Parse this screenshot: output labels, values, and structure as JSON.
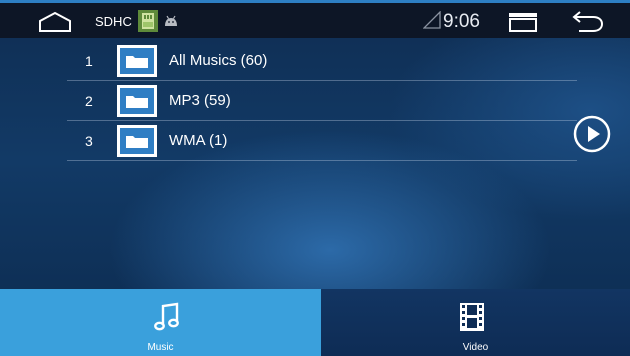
{
  "status_bar": {
    "storage_label": "SDHC",
    "time": "9:06",
    "icons": [
      "home-icon",
      "sd-card-icon",
      "android-debug-icon",
      "signal-icon",
      "recent-apps-icon",
      "back-icon"
    ]
  },
  "playlist": {
    "items": [
      {
        "index": "1",
        "label": "All Musics (60)",
        "icon": "folder-icon"
      },
      {
        "index": "2",
        "label": "MP3 (59)",
        "icon": "folder-icon"
      },
      {
        "index": "3",
        "label": "WMA (1)",
        "icon": "folder-icon"
      }
    ]
  },
  "play_button": {
    "icon": "play-icon"
  },
  "tabs": [
    {
      "label": "Music",
      "icon": "music-note-icon",
      "selected": true
    },
    {
      "label": "Video",
      "icon": "film-icon",
      "selected": false
    }
  ],
  "colors": {
    "status_bar_bg": "#0d1626",
    "accent": "#3aa0dc",
    "background": "#123a66",
    "folder_blue": "#2f7ec4"
  }
}
